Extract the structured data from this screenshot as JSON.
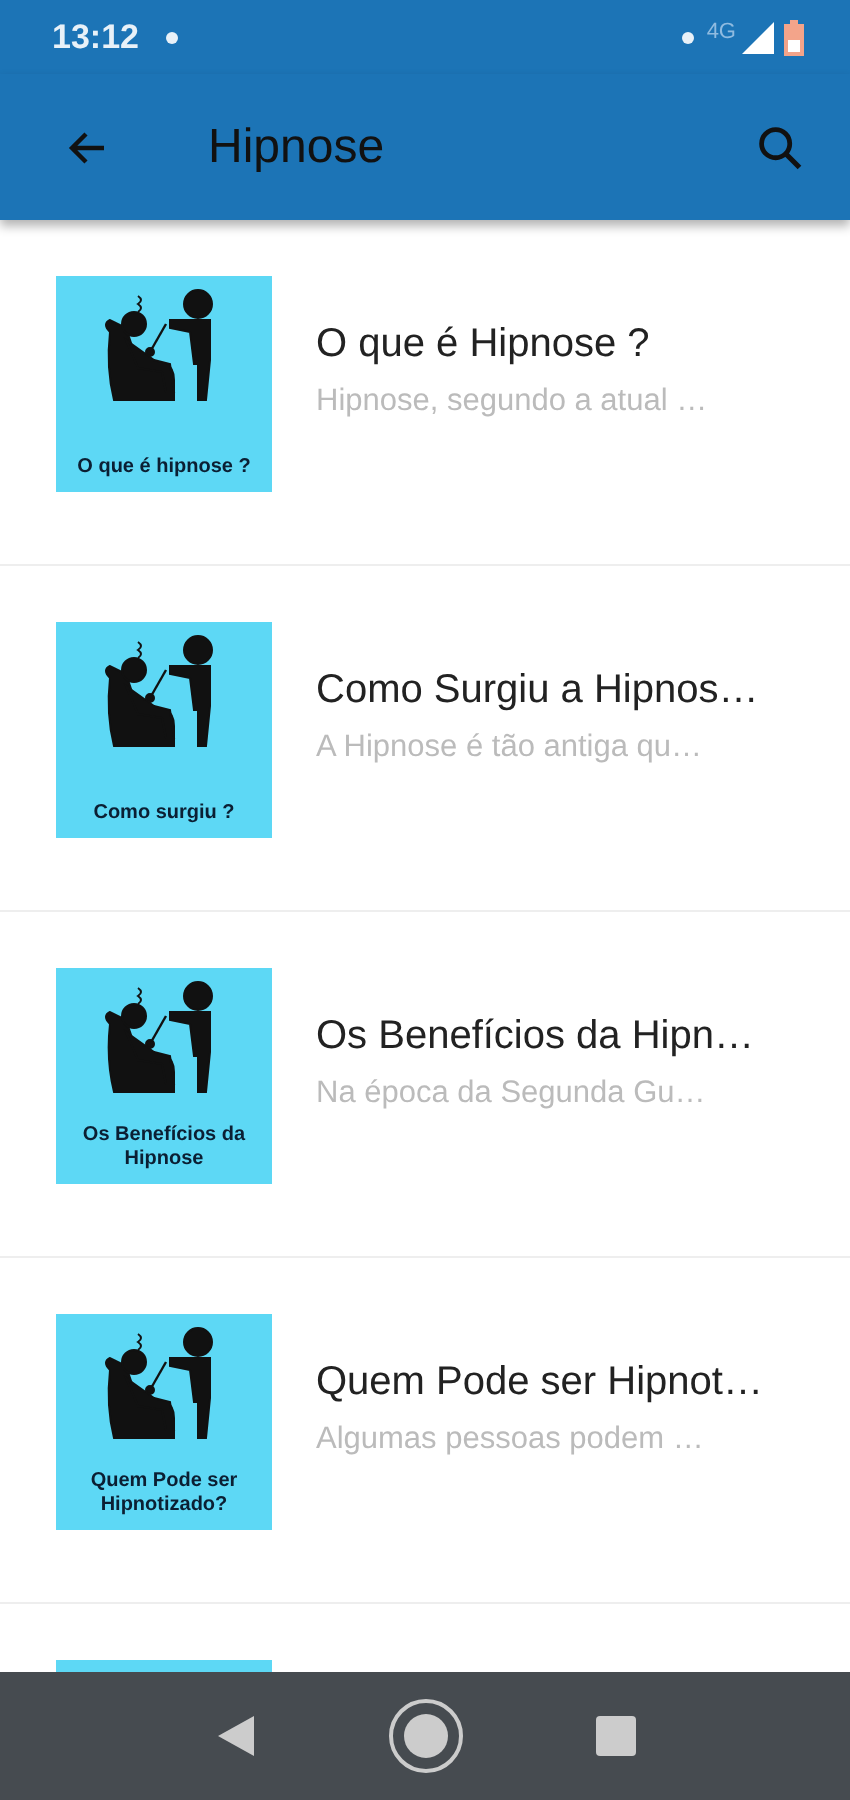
{
  "status_bar": {
    "time": "13:12",
    "network": "4G"
  },
  "app_bar": {
    "title": "Hipnose"
  },
  "items": [
    {
      "kind": "article",
      "caption": "O que é hipnose ?",
      "title": "O que é Hipnose ?",
      "subtitle": "Hipnose, segundo a atual …"
    },
    {
      "kind": "article",
      "caption": "Como surgiu ?",
      "title": "Como Surgiu a Hipnos…",
      "subtitle": "A Hipnose é tão antiga qu…"
    },
    {
      "kind": "article",
      "caption": "Os Benefícios da Hipnose",
      "title": "Os Benefícios da Hipn…",
      "subtitle": "Na época da Segunda Gu…"
    },
    {
      "kind": "article",
      "caption": "Quem Pode ser Hipnotizado?",
      "title": "Quem Pode ser Hipnot…",
      "subtitle": "Algumas pessoas podem …"
    },
    {
      "kind": "article"
    }
  ]
}
